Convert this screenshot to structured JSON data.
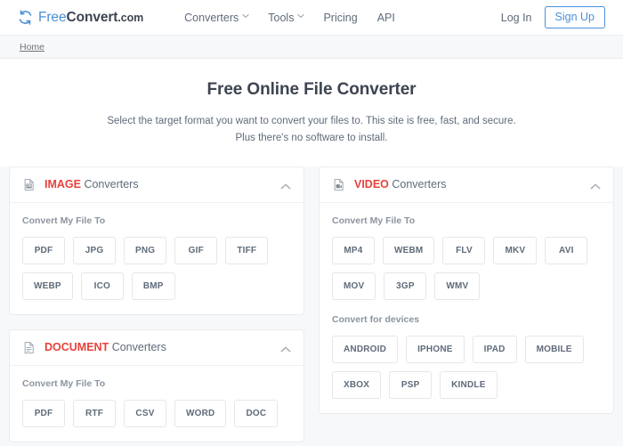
{
  "colors": {
    "brand_blue": "#4a90d9",
    "category_red": "#e8413a",
    "text_dark": "#3d4451",
    "text_muted": "#5f6b7a",
    "page_bg": "#f7f8f9",
    "card_border": "#e9ecef"
  },
  "header": {
    "logo": {
      "icon": "refresh-circle-icon",
      "part_free": "Free",
      "part_convert": "Convert",
      "part_dotcom": ".com"
    },
    "nav": [
      {
        "label": "Converters",
        "has_dropdown": true
      },
      {
        "label": "Tools",
        "has_dropdown": true
      },
      {
        "label": "Pricing",
        "has_dropdown": false
      },
      {
        "label": "API",
        "has_dropdown": false
      }
    ],
    "login_label": "Log In",
    "signup_label": "Sign Up"
  },
  "breadcrumb": {
    "items": [
      "Home"
    ]
  },
  "hero": {
    "title": "Free Online File Converter",
    "subtitle": "Select the target format you want to convert your files to. This site is free, fast, and secure. Plus there's no software to install."
  },
  "cards": {
    "image": {
      "icon": "image-file-icon",
      "category": "IMAGE",
      "suffix": " Converters",
      "toggle_icon": "chevron-up-icon",
      "sections": [
        {
          "label": "Convert My File To",
          "chips": [
            "PDF",
            "JPG",
            "PNG",
            "GIF",
            "TIFF",
            "WEBP",
            "ICO",
            "BMP"
          ]
        }
      ]
    },
    "document": {
      "icon": "document-file-icon",
      "category": "DOCUMENT",
      "suffix": " Converters",
      "toggle_icon": "chevron-up-icon",
      "sections": [
        {
          "label": "Convert My File To",
          "chips": [
            "PDF",
            "RTF",
            "CSV",
            "WORD",
            "DOC"
          ]
        }
      ]
    },
    "video": {
      "icon": "video-file-icon",
      "category": "VIDEO",
      "suffix": " Converters",
      "toggle_icon": "chevron-up-icon",
      "sections": [
        {
          "label": "Convert My File To",
          "chips": [
            "MP4",
            "WEBM",
            "FLV",
            "MKV",
            "AVI",
            "MOV",
            "3GP",
            "WMV"
          ]
        },
        {
          "label": "Convert for devices",
          "chips": [
            "ANDROID",
            "IPHONE",
            "IPAD",
            "MOBILE",
            "XBOX",
            "PSP",
            "KINDLE"
          ]
        }
      ]
    }
  }
}
